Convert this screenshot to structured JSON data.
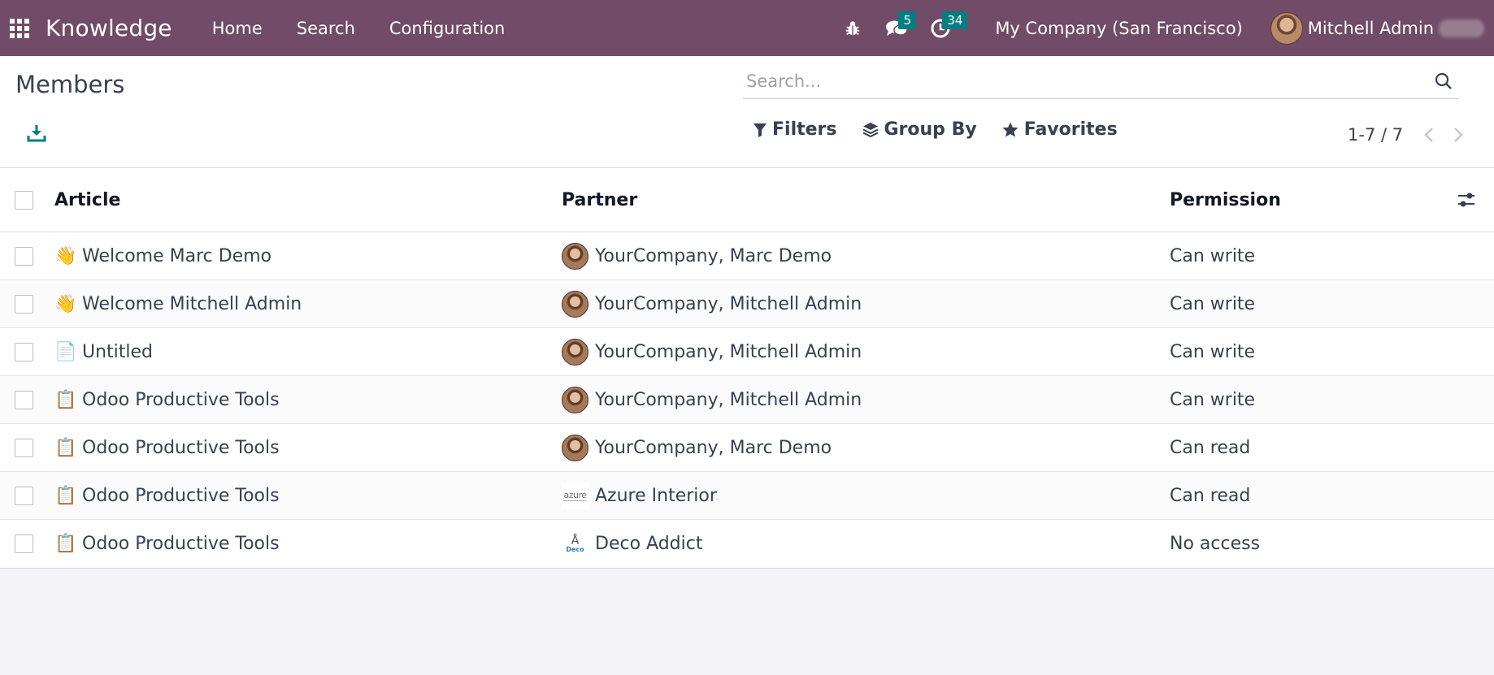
{
  "navbar": {
    "app_name": "Knowledge",
    "menu": [
      "Home",
      "Search",
      "Configuration"
    ],
    "messages_count": "5",
    "activities_count": "34",
    "company": "My Company (San Francisco)",
    "user_name": "Mitchell Admin"
  },
  "control_panel": {
    "title": "Members",
    "search_placeholder": "Search...",
    "filters_label": "Filters",
    "groupby_label": "Group By",
    "favorites_label": "Favorites",
    "pager": "1-7 / 7"
  },
  "table": {
    "columns": [
      "Article",
      "Partner",
      "Permission"
    ],
    "rows": [
      {
        "icon": "👋",
        "article": "Welcome Marc Demo",
        "partner": "YourCompany, Marc Demo",
        "partner_avatar": "person",
        "permission": "Can write"
      },
      {
        "icon": "👋",
        "article": "Welcome Mitchell Admin",
        "partner": "YourCompany, Mitchell Admin",
        "partner_avatar": "person",
        "permission": "Can write"
      },
      {
        "icon": "📄",
        "article": "Untitled",
        "partner": "YourCompany, Mitchell Admin",
        "partner_avatar": "person",
        "permission": "Can write"
      },
      {
        "icon": "📋",
        "article": "Odoo Productive Tools",
        "partner": "YourCompany, Mitchell Admin",
        "partner_avatar": "person",
        "permission": "Can write"
      },
      {
        "icon": "📋",
        "article": "Odoo Productive Tools",
        "partner": "YourCompany, Marc Demo",
        "partner_avatar": "person",
        "permission": "Can read"
      },
      {
        "icon": "📋",
        "article": "Odoo Productive Tools",
        "partner": "Azure Interior",
        "partner_avatar": "azure",
        "permission": "Can read"
      },
      {
        "icon": "📋",
        "article": "Odoo Productive Tools",
        "partner": "Deco Addict",
        "partner_avatar": "deco",
        "permission": "No access"
      }
    ]
  },
  "partner_logos": {
    "azure": "azure",
    "deco": "Deco"
  },
  "colors": {
    "brand": "#714b67",
    "badge": "#017e84"
  }
}
